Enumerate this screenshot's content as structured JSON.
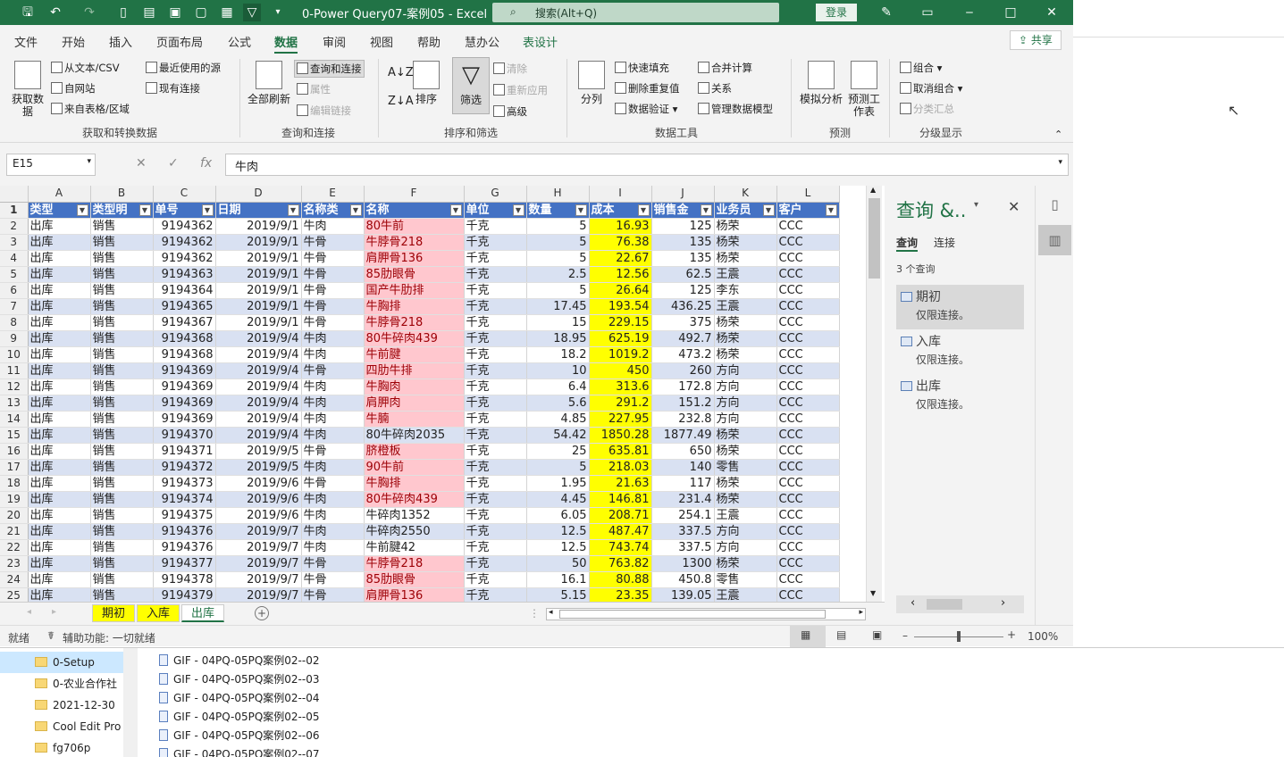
{
  "titlebar": {
    "title": "0-Power Query07-案例05  -  Excel",
    "search": "搜索(Alt+Q)",
    "login": "登录"
  },
  "tabs": [
    "文件",
    "开始",
    "插入",
    "页面布局",
    "公式",
    "数据",
    "审阅",
    "视图",
    "帮助",
    "慧办公",
    "表设计"
  ],
  "share": "共享",
  "ribbon": {
    "get": {
      "big": "获取数据",
      "b1": "从文本/CSV",
      "b2": "自网站",
      "b3": "来自表格/区域",
      "b4": "最近使用的源",
      "b5": "现有连接",
      "group": "获取和转换数据"
    },
    "query": {
      "big": "全部刷新",
      "b1": "查询和连接",
      "b2": "属性",
      "b3": "编辑链接",
      "group": "查询和连接"
    },
    "sort": {
      "big": "排序",
      "filter": "筛选",
      "b1": "清除",
      "b2": "重新应用",
      "b3": "高级",
      "group": "排序和筛选"
    },
    "tools": {
      "big": "分列",
      "b1": "快速填充",
      "b2": "删除重复值",
      "b3": "数据验证",
      "b4": "合并计算",
      "b5": "关系",
      "b6": "管理数据模型",
      "group": "数据工具"
    },
    "forecast": {
      "b1": "模拟分析",
      "b2": "预测工作表",
      "group": "预测"
    },
    "outline": {
      "b1": "组合",
      "b2": "取消组合",
      "b3": "分类汇总",
      "group": "分级显示"
    }
  },
  "formula": {
    "name": "E15",
    "fx": "fx",
    "value": "牛肉"
  },
  "columns": [
    "A",
    "B",
    "C",
    "D",
    "E",
    "F",
    "G",
    "H",
    "I",
    "J",
    "K",
    "L"
  ],
  "headers": [
    "类型",
    "类型明",
    "单号",
    "日期",
    "名称类",
    "名称",
    "单位",
    "数量",
    "成本",
    "销售金",
    "业务员",
    "客户"
  ],
  "rows": [
    [
      "出库",
      "销售",
      "9194362",
      "2019/9/1",
      "牛肉",
      "80牛前",
      "千克",
      "5",
      "16.93",
      "125",
      "杨荣",
      "CCC"
    ],
    [
      "出库",
      "销售",
      "9194362",
      "2019/9/1",
      "牛骨",
      "牛脖骨218",
      "千克",
      "5",
      "76.38",
      "135",
      "杨荣",
      "CCC"
    ],
    [
      "出库",
      "销售",
      "9194362",
      "2019/9/1",
      "牛骨",
      "肩胛骨136",
      "千克",
      "5",
      "22.67",
      "135",
      "杨荣",
      "CCC"
    ],
    [
      "出库",
      "销售",
      "9194363",
      "2019/9/1",
      "牛骨",
      "85肋眼骨",
      "千克",
      "2.5",
      "12.56",
      "62.5",
      "王震",
      "CCC"
    ],
    [
      "出库",
      "销售",
      "9194364",
      "2019/9/1",
      "牛骨",
      "国产牛肋排",
      "千克",
      "5",
      "26.64",
      "125",
      "李东",
      "CCC"
    ],
    [
      "出库",
      "销售",
      "9194365",
      "2019/9/1",
      "牛骨",
      "牛胸排",
      "千克",
      "17.45",
      "193.54",
      "436.25",
      "王震",
      "CCC"
    ],
    [
      "出库",
      "销售",
      "9194367",
      "2019/9/1",
      "牛骨",
      "牛脖骨218",
      "千克",
      "15",
      "229.15",
      "375",
      "杨荣",
      "CCC"
    ],
    [
      "出库",
      "销售",
      "9194368",
      "2019/9/4",
      "牛肉",
      "80牛碎肉439",
      "千克",
      "18.95",
      "625.19",
      "492.7",
      "杨荣",
      "CCC"
    ],
    [
      "出库",
      "销售",
      "9194368",
      "2019/9/4",
      "牛肉",
      "牛前腱",
      "千克",
      "18.2",
      "1019.2",
      "473.2",
      "杨荣",
      "CCC"
    ],
    [
      "出库",
      "销售",
      "9194369",
      "2019/9/4",
      "牛骨",
      "四肋牛排",
      "千克",
      "10",
      "450",
      "260",
      "方向",
      "CCC"
    ],
    [
      "出库",
      "销售",
      "9194369",
      "2019/9/4",
      "牛肉",
      "牛胸肉",
      "千克",
      "6.4",
      "313.6",
      "172.8",
      "方向",
      "CCC"
    ],
    [
      "出库",
      "销售",
      "9194369",
      "2019/9/4",
      "牛肉",
      "肩胛肉",
      "千克",
      "5.6",
      "291.2",
      "151.2",
      "方向",
      "CCC"
    ],
    [
      "出库",
      "销售",
      "9194369",
      "2019/9/4",
      "牛肉",
      "牛腩",
      "千克",
      "4.85",
      "227.95",
      "232.8",
      "方向",
      "CCC"
    ],
    [
      "出库",
      "销售",
      "9194370",
      "2019/9/4",
      "牛肉",
      "80牛碎肉2035",
      "千克",
      "54.42",
      "1850.28",
      "1877.49",
      "杨荣",
      "CCC"
    ],
    [
      "出库",
      "销售",
      "9194371",
      "2019/9/5",
      "牛骨",
      "脐橙板",
      "千克",
      "25",
      "635.81",
      "650",
      "杨荣",
      "CCC"
    ],
    [
      "出库",
      "销售",
      "9194372",
      "2019/9/5",
      "牛肉",
      "90牛前",
      "千克",
      "5",
      "218.03",
      "140",
      "零售",
      "CCC"
    ],
    [
      "出库",
      "销售",
      "9194373",
      "2019/9/6",
      "牛骨",
      "牛胸排",
      "千克",
      "1.95",
      "21.63",
      "117",
      "杨荣",
      "CCC"
    ],
    [
      "出库",
      "销售",
      "9194374",
      "2019/9/6",
      "牛肉",
      "80牛碎肉439",
      "千克",
      "4.45",
      "146.81",
      "231.4",
      "杨荣",
      "CCC"
    ],
    [
      "出库",
      "销售",
      "9194375",
      "2019/9/6",
      "牛肉",
      "牛碎肉1352",
      "千克",
      "6.05",
      "208.71",
      "254.1",
      "王震",
      "CCC"
    ],
    [
      "出库",
      "销售",
      "9194376",
      "2019/9/7",
      "牛肉",
      "牛碎肉2550",
      "千克",
      "12.5",
      "487.47",
      "337.5",
      "方向",
      "CCC"
    ],
    [
      "出库",
      "销售",
      "9194376",
      "2019/9/7",
      "牛肉",
      "牛前腱42",
      "千克",
      "12.5",
      "743.74",
      "337.5",
      "方向",
      "CCC"
    ],
    [
      "出库",
      "销售",
      "9194377",
      "2019/9/7",
      "牛骨",
      "牛脖骨218",
      "千克",
      "50",
      "763.82",
      "1300",
      "杨荣",
      "CCC"
    ],
    [
      "出库",
      "销售",
      "9194378",
      "2019/9/7",
      "牛骨",
      "85肋眼骨",
      "千克",
      "16.1",
      "80.88",
      "450.8",
      "零售",
      "CCC"
    ],
    [
      "出库",
      "销售",
      "9194379",
      "2019/9/7",
      "牛骨",
      "肩胛骨136",
      "千克",
      "5.15",
      "23.35",
      "139.05",
      "王震",
      "CCC"
    ]
  ],
  "pink_rows": [
    0,
    1,
    2,
    3,
    4,
    5,
    6,
    7,
    8,
    9,
    10,
    11,
    12,
    14,
    15,
    16,
    17,
    21,
    22,
    23
  ],
  "sheets": [
    "期初",
    "入库",
    "出库"
  ],
  "active_sheet": "出库",
  "query_pane": {
    "title": "查询 &..",
    "tab1": "查询",
    "tab2": "连接",
    "count": "3 个查询",
    "items": [
      {
        "name": "期初",
        "sub": "仅限连接。"
      },
      {
        "name": "入库",
        "sub": "仅限连接。"
      },
      {
        "name": "出库",
        "sub": "仅限连接。"
      }
    ]
  },
  "status": {
    "ready": "就绪",
    "access": "辅助功能: 一切就绪",
    "zoom": "100%"
  },
  "explorer": {
    "folders": [
      "0-Setup",
      "0-农业合作社",
      "2021-12-30",
      "Cool Edit Pro",
      "fg706p"
    ],
    "files": [
      "GIF - 04PQ-05PQ案例02--02",
      "GIF - 04PQ-05PQ案例02--03",
      "GIF - 04PQ-05PQ案例02--04",
      "GIF - 04PQ-05PQ案例02--05",
      "GIF - 04PQ-05PQ案例02--06",
      "GIF - 04PQ-05PQ案例02--07"
    ]
  },
  "colors": {
    "accent": "#217346",
    "header": "#4472c4",
    "band": "#d9e1f2",
    "pink": "#ffc7ce",
    "yellow": "#ffff00"
  }
}
